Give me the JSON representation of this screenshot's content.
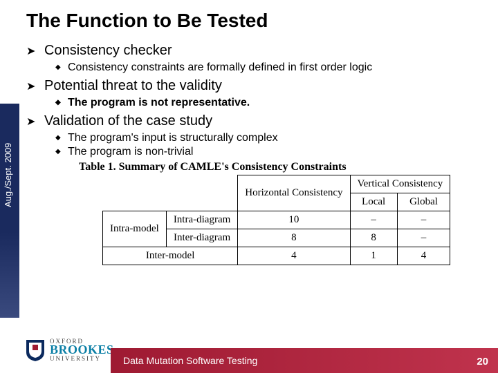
{
  "title": "The Function to Be Tested",
  "side_label": "Aug./Sept. 2009",
  "bullets": {
    "b1": "Consistency checker",
    "b1_1": "Consistency constraints are formally defined in first order logic",
    "b2": "Potential threat to the validity",
    "b2_1": "The program is not representative.",
    "b3": "Validation of the case study",
    "b3_1": "The program's input is structurally complex",
    "b3_2": "The program is non-trivial"
  },
  "table": {
    "caption": "Table 1. Summary of CAMLE's Consistency Constraints",
    "col_horizontal": "Horizontal Consistency",
    "col_vertical": "Vertical Consistency",
    "col_local": "Local",
    "col_global": "Global",
    "row_intra_model": "Intra-model",
    "row_intra_diagram": "Intra-diagram",
    "row_inter_diagram": "Inter-diagram",
    "row_inter_model": "Inter-model",
    "v": {
      "r1c1": "10",
      "r1c2": "–",
      "r1c3": "–",
      "r2c1": "8",
      "r2c2": "8",
      "r2c3": "–",
      "r3c1": "4",
      "r3c2": "1",
      "r3c3": "4"
    }
  },
  "logo": {
    "line1": "OXFORD",
    "line2": "BROOKES",
    "line3": "UNIVERSITY"
  },
  "footer": "Data Mutation Software Testing",
  "page_num": "20"
}
